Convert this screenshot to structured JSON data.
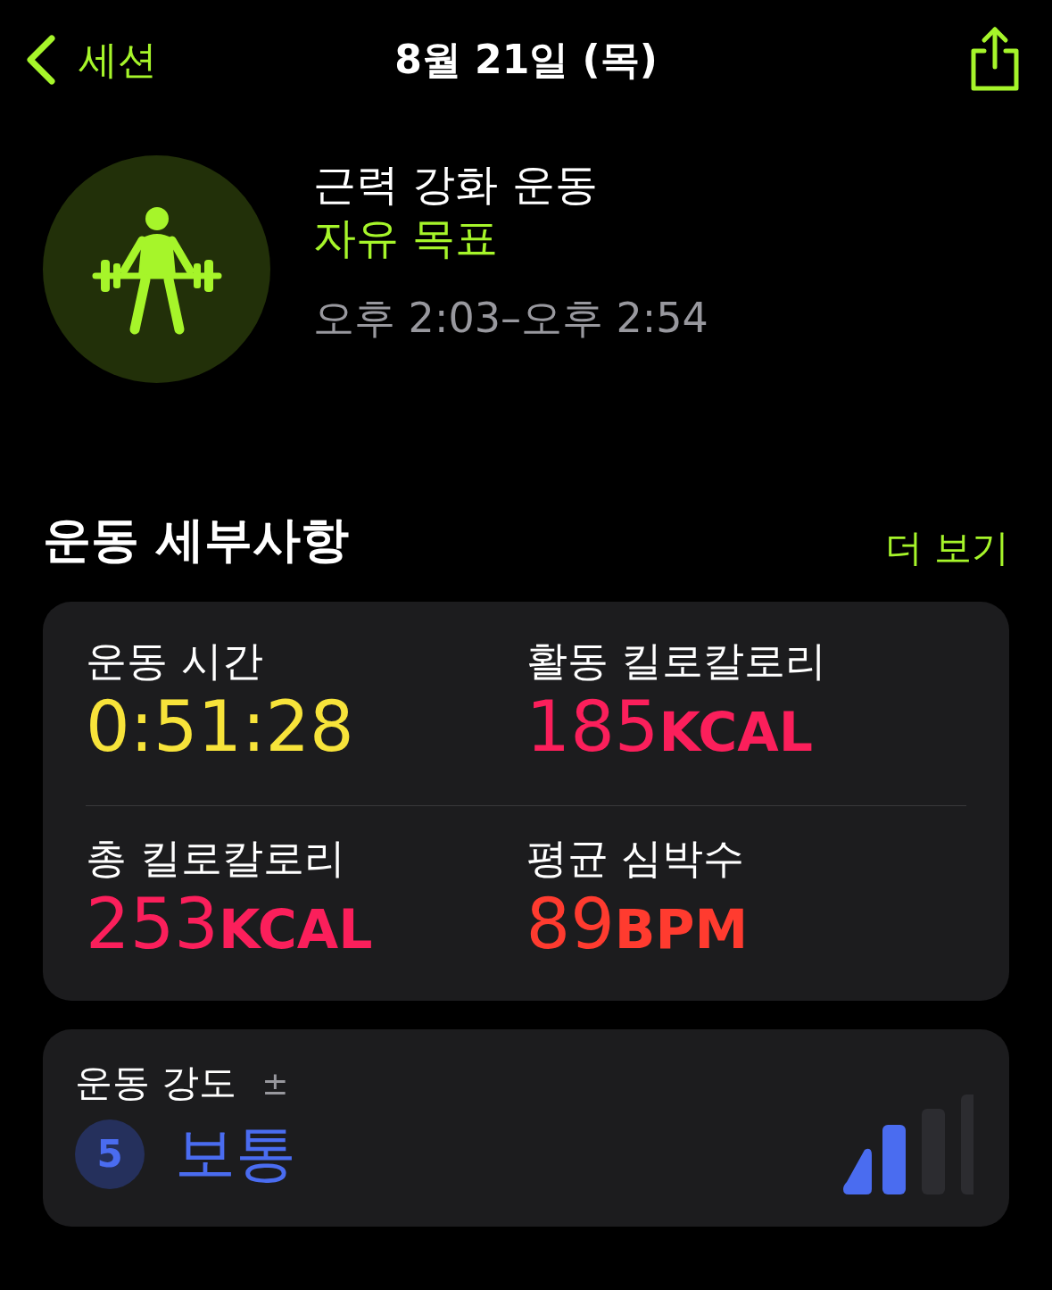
{
  "nav": {
    "back_label": "세션",
    "title": "8월 21일 (목)"
  },
  "workout": {
    "name": "근력 강화 운동",
    "goal": "자유 목표",
    "time_range": "오후 2:03–오후 2:54"
  },
  "details": {
    "heading": "운동 세부사항",
    "more_link": "더 보기",
    "metrics": [
      {
        "label": "운동 시간",
        "value": "0:51:28",
        "color": "#f7e33a"
      },
      {
        "label": "활동 킬로칼로리",
        "value": "185",
        "unit": "KCAL",
        "color": "#fb1f5b"
      },
      {
        "label": "총 킬로칼로리",
        "value": "253",
        "unit": "KCAL",
        "color": "#fb1f5b"
      },
      {
        "label": "평균 심박수",
        "value": "89",
        "unit": "BPM",
        "color": "#ff3b2f"
      }
    ]
  },
  "intensity": {
    "label": "운동 강도",
    "symbol": "±",
    "score": "5",
    "level_text": "보통"
  }
}
